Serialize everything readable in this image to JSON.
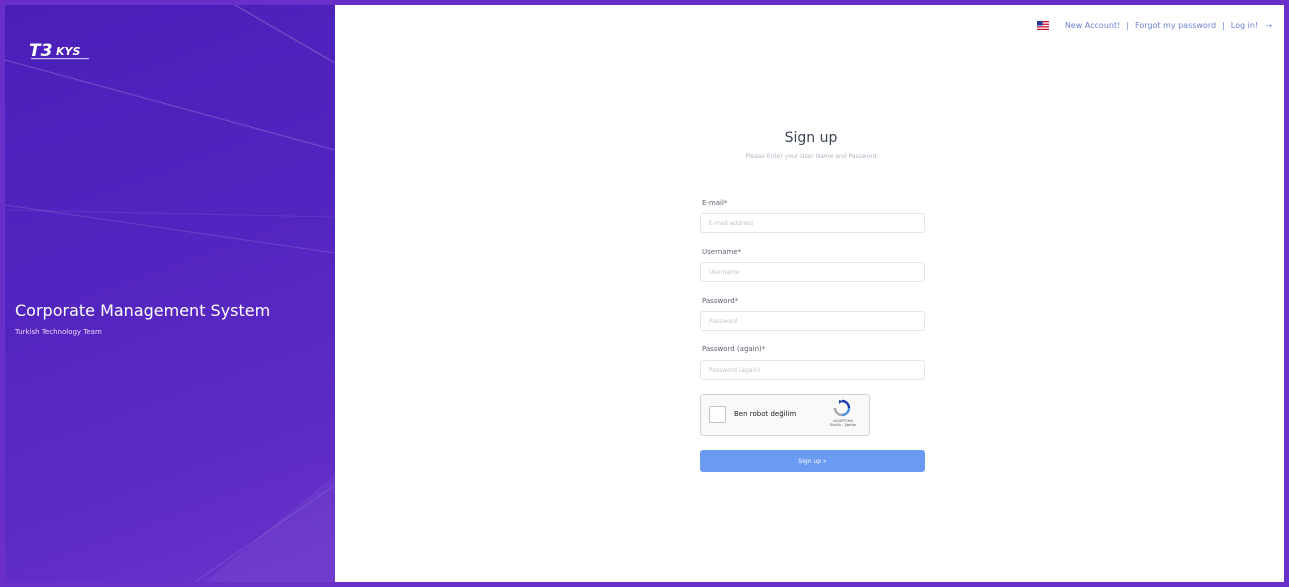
{
  "sidebar": {
    "logo_text": "T3KYS",
    "title": "Corporate Management System",
    "subtitle": "Turkish Technology Team"
  },
  "topnav": {
    "language_icon": "us-flag-icon",
    "new_account": "New Account!",
    "separator": "|",
    "forgot_password": "Forgot my password",
    "login": "Log in!",
    "chevron": "→"
  },
  "form": {
    "title": "Sign up",
    "subtitle": "Please Enter your User Name and Password",
    "email_label": "E-mail*",
    "email_placeholder": "E-mail address",
    "username_label": "Username*",
    "username_placeholder": "Username",
    "password_label": "Password*",
    "password_placeholder": "Password",
    "password_again_label": "Password (again)*",
    "password_again_placeholder": "Password (again)",
    "submit_label": "Sign up »"
  },
  "captcha": {
    "label": "Ben robot değilim",
    "brand": "reCAPTCHA",
    "links": "Gizlilik - Şartlar"
  },
  "colors": {
    "sidebar": "#5325c0",
    "button": "#6b9af2",
    "link": "#6b83d6"
  }
}
